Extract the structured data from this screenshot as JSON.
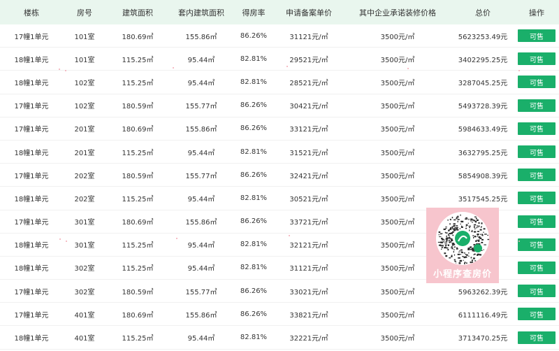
{
  "table": {
    "headers": [
      "楼栋",
      "房号",
      "建筑面积",
      "套内建筑面积",
      "得房率",
      "申请备案单价",
      "其中企业承诺装修价格",
      "总价",
      "操作"
    ],
    "rows": [
      [
        "17幢1单元",
        "101室",
        "180.69㎡",
        "155.86㎡",
        "86.26%",
        "31121元/㎡",
        "3500元/㎡",
        "5623253.49元",
        "可售"
      ],
      [
        "18幢1单元",
        "101室",
        "115.25㎡",
        "95.44㎡",
        "82.81%",
        "29521元/㎡",
        "3500元/㎡",
        "3402295.25元",
        "可售"
      ],
      [
        "18幢1单元",
        "102室",
        "115.25㎡",
        "95.44㎡",
        "82.81%",
        "28521元/㎡",
        "3500元/㎡",
        "3287045.25元",
        "可售"
      ],
      [
        "17幢1单元",
        "102室",
        "180.59㎡",
        "155.77㎡",
        "86.26%",
        "30421元/㎡",
        "3500元/㎡",
        "5493728.39元",
        "可售"
      ],
      [
        "17幢1单元",
        "201室",
        "180.69㎡",
        "155.86㎡",
        "86.26%",
        "33121元/㎡",
        "3500元/㎡",
        "5984633.49元",
        "可售"
      ],
      [
        "18幢1单元",
        "201室",
        "115.25㎡",
        "95.44㎡",
        "82.81%",
        "31521元/㎡",
        "3500元/㎡",
        "3632795.25元",
        "可售"
      ],
      [
        "17幢1单元",
        "202室",
        "180.59㎡",
        "155.77㎡",
        "86.26%",
        "32421元/㎡",
        "3500元/㎡",
        "5854908.39元",
        "可售"
      ],
      [
        "18幢1单元",
        "202室",
        "115.25㎡",
        "95.44㎡",
        "82.81%",
        "30521元/㎡",
        "3500元/㎡",
        "3517545.25元",
        "可售"
      ],
      [
        "17幢1单元",
        "301室",
        "180.69㎡",
        "155.86㎡",
        "86.26%",
        "33721元/㎡",
        "3500元/㎡",
        "",
        "可售"
      ],
      [
        "18幢1单元",
        "301室",
        "115.25㎡",
        "95.44㎡",
        "82.81%",
        "32121元/㎡",
        "3500元/㎡",
        "",
        "可售"
      ],
      [
        "18幢1单元",
        "302室",
        "115.25㎡",
        "95.44㎡",
        "82.81%",
        "31121元/㎡",
        "3500元/㎡",
        "",
        "可售"
      ],
      [
        "17幢1单元",
        "302室",
        "180.59㎡",
        "155.77㎡",
        "86.26%",
        "33021元/㎡",
        "3500元/㎡",
        "5963262.39元",
        "可售"
      ],
      [
        "17幢1单元",
        "401室",
        "180.69㎡",
        "155.86㎡",
        "86.26%",
        "33821元/㎡",
        "3500元/㎡",
        "6111116.49元",
        "可售"
      ],
      [
        "18幢1单元",
        "401室",
        "115.25㎡",
        "95.44㎡",
        "82.81%",
        "32221元/㎡",
        "3500元/㎡",
        "3713470.25元",
        "可售"
      ]
    ]
  },
  "overlay": {
    "label": "小程序查房价",
    "icon": "qr-code-icon"
  },
  "colors": {
    "header_bg": "#e9f6ee",
    "button_bg": "#1aaf6a",
    "overlay_bg": "#f7c5cd"
  }
}
